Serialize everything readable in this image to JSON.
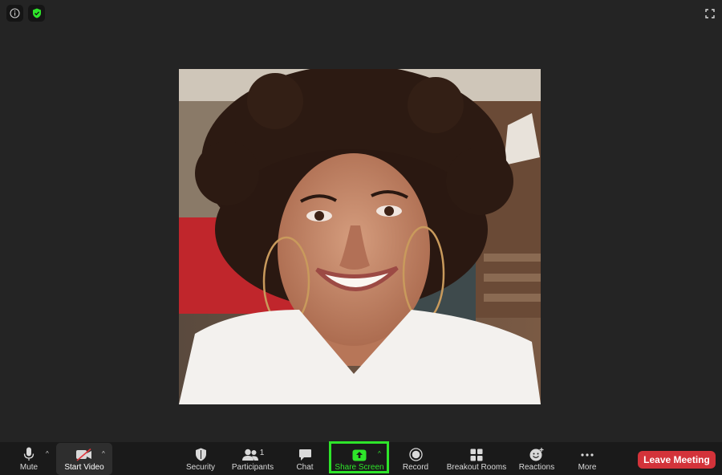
{
  "colors": {
    "accent_green": "#2ee52a",
    "leave_red": "#d3333a",
    "bg": "#242424"
  },
  "participants_count": "1",
  "toolbar": {
    "mute": "Mute",
    "start_video": "Start Video",
    "security": "Security",
    "participants": "Participants",
    "chat": "Chat",
    "share_screen": "Share Screen",
    "record": "Record",
    "breakout_rooms": "Breakout Rooms",
    "reactions": "Reactions",
    "more": "More",
    "leave": "Leave Meeting"
  }
}
